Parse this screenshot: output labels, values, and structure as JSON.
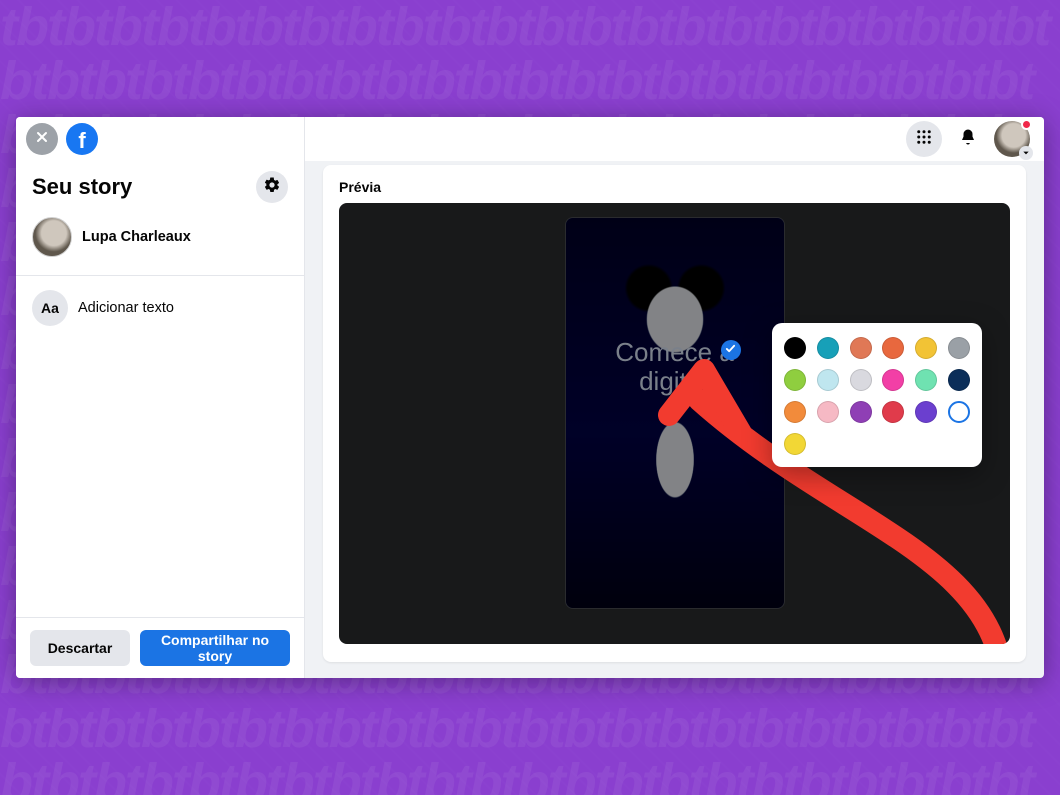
{
  "sidebar": {
    "title": "Seu story",
    "user_name": "Lupa Charleaux",
    "add_text_label": "Adicionar texto",
    "add_text_icon_label": "Aa",
    "discard_label": "Descartar",
    "share_label": "Compartilhar no story"
  },
  "preview": {
    "label": "Prévia",
    "placeholder_line1": "Comece a",
    "placeholder_line2": "digitar"
  },
  "palette": {
    "colors": [
      "#000000",
      "#17a0b8",
      "#e07856",
      "#e8683e",
      "#f2c335",
      "#9aa0a6",
      "#8fce3f",
      "#bfe6ef",
      "#d9d9df",
      "#f23fa6",
      "#6fe2b1",
      "#0b2e59",
      "#f28b3b",
      "#f6b9c4",
      "#8f3fb5",
      "#e03b4b",
      "#6b3fcf",
      "hollow",
      "#f2d735"
    ]
  }
}
